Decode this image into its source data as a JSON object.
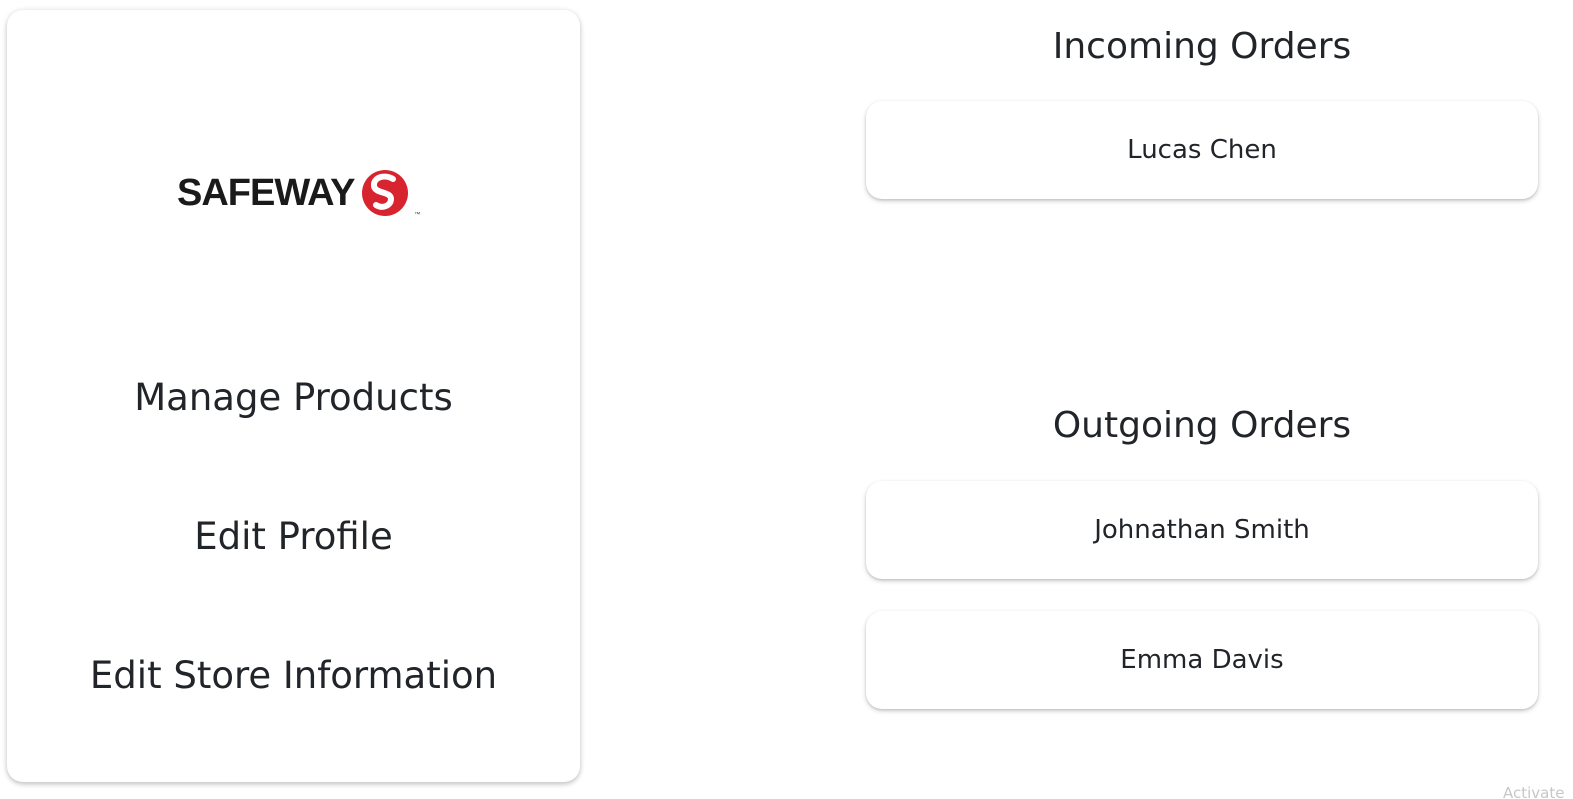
{
  "sidebar": {
    "logo_text": "SAFEWAY",
    "logo_tm": "™",
    "items": [
      {
        "label": "Manage Products"
      },
      {
        "label": "Edit Profile"
      },
      {
        "label": "Edit Store Information"
      }
    ]
  },
  "incoming": {
    "title": "Incoming Orders",
    "orders": [
      {
        "name": "Lucas Chen"
      }
    ]
  },
  "outgoing": {
    "title": "Outgoing Orders",
    "orders": [
      {
        "name": "Johnathan Smith"
      },
      {
        "name": "Emma Davis"
      }
    ]
  },
  "watermark": "Activate",
  "colors": {
    "brand_red": "#d8242f",
    "text": "#212529",
    "background": "#ffffff"
  }
}
